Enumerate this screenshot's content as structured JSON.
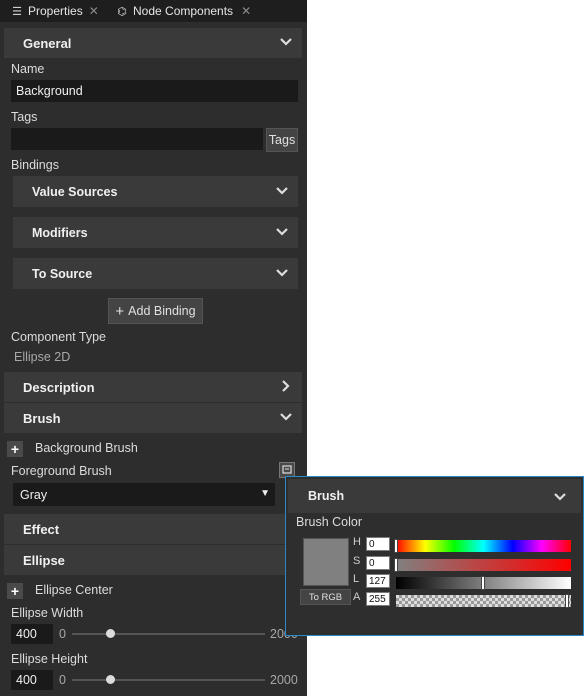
{
  "tabs": [
    {
      "label": "Properties",
      "icon": "list-icon"
    },
    {
      "label": "Node Components",
      "icon": "components-icon"
    }
  ],
  "sections": {
    "general": "General",
    "description": "Description",
    "brush": "Brush",
    "effect": "Effect",
    "ellipse": "Ellipse"
  },
  "general": {
    "name_label": "Name",
    "name_value": "Background",
    "tags_label": "Tags",
    "tags_value": "",
    "tags_button": "Tags",
    "bindings_label": "Bindings",
    "binding_groups": [
      "Value Sources",
      "Modifiers",
      "To Source"
    ],
    "add_binding": "Add Binding",
    "component_type_label": "Component Type",
    "component_type_value": "Ellipse 2D"
  },
  "brush": {
    "background_brush": "Background Brush",
    "foreground_label": "Foreground Brush",
    "foreground_value": "Gray"
  },
  "ellipse": {
    "center_label": "Ellipse Center",
    "width_label": "Ellipse Width",
    "width_value": "400",
    "width_min": "0",
    "width_max": "2000",
    "height_label": "Ellipse Height",
    "height_value": "400",
    "height_min": "0",
    "height_max": "2000"
  },
  "popup": {
    "title": "Brush",
    "color_label": "Brush Color",
    "to_rgb": "To RGB",
    "swatch_color": "#808080",
    "channels": [
      {
        "name": "H",
        "value": "0"
      },
      {
        "name": "S",
        "value": "0"
      },
      {
        "name": "L",
        "value": "127"
      },
      {
        "name": "A",
        "value": "255"
      }
    ]
  }
}
